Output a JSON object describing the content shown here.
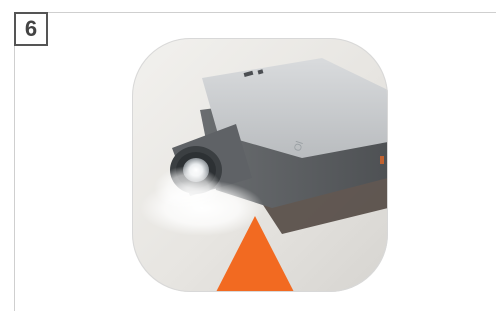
{
  "step": {
    "number": "6"
  },
  "illustration": {
    "icon_name": "flashlight-app-icon",
    "colors": {
      "background": "#e6e4e0",
      "device_body": "#5f6164",
      "device_top": "#cfd1d3",
      "lens_ring": "#3b3f42",
      "light_glow": "#ffffff",
      "accent_triangle": "#f26a21"
    }
  }
}
